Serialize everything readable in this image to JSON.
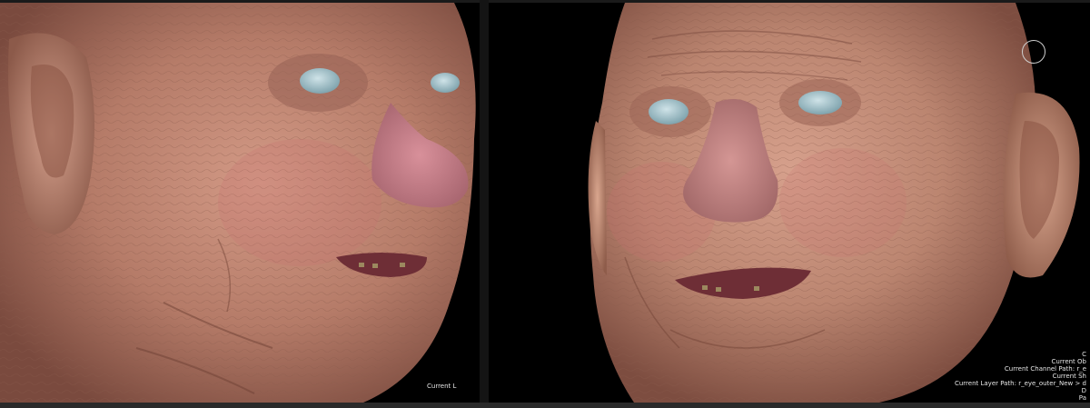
{
  "viewports": {
    "left": {
      "label": "Current L"
    },
    "right": {
      "hud_lines": [
        "C",
        "Current Ob",
        "Current Channel Path: r_e",
        "Current Sh",
        "Current Layer Path: r_eye_outer_New > d",
        "D",
        "Pa"
      ]
    }
  },
  "colors": {
    "background": "#000000",
    "skin_base": "#c8907c",
    "skin_shadow": "#7a4a3e",
    "eye": "#a9c4cc",
    "hud_text": "#e6e6e6"
  },
  "icons": {
    "brush_cursor": "brush-circle-icon"
  }
}
